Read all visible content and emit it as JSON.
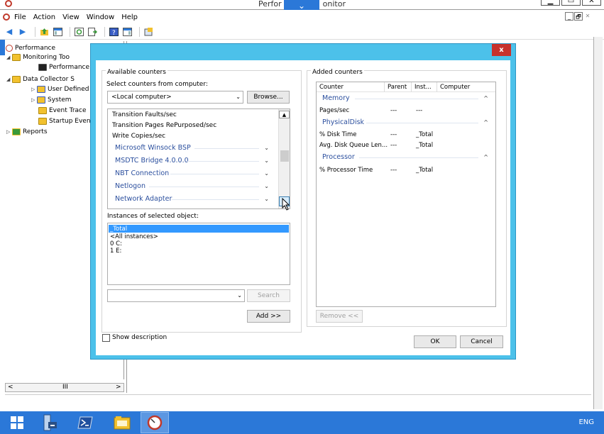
{
  "window": {
    "title": "Performance Monitor",
    "title_left": "Perfor",
    "title_right": "onitor",
    "chevron": "⌄",
    "controls": [
      "▁",
      "▭",
      "✕"
    ]
  },
  "menu": {
    "items": [
      "File",
      "Action",
      "View",
      "Window",
      "Help"
    ]
  },
  "mdi_controls": [
    "_",
    "🗗",
    "✕"
  ],
  "tree": {
    "nodes": [
      {
        "label": "Performance",
        "expander": ""
      },
      {
        "label": "Monitoring Too",
        "expander": "◢"
      },
      {
        "label": "Performance",
        "expander": ""
      },
      {
        "label": "Data Collector S",
        "expander": "◢"
      },
      {
        "label": "User Defined",
        "expander": "▷"
      },
      {
        "label": "System",
        "expander": "▷"
      },
      {
        "label": "Event Trace",
        "expander": ""
      },
      {
        "label": "Startup Even",
        "expander": ""
      },
      {
        "label": "Reports",
        "expander": "▷"
      }
    ],
    "hscroll_left": "<",
    "hscroll_thumb": "III",
    "hscroll_right": ">"
  },
  "dialog": {
    "close": "x",
    "available_title": "Available counters",
    "select_computer_label": "Select counters from computer:",
    "computer_value": "<Local computer>",
    "browse_label": "Browse...",
    "counters": [
      "Transition Faults/sec",
      "Transition Pages RePurposed/sec",
      "Write Copies/sec"
    ],
    "categories": [
      "Microsoft Winsock BSP",
      "MSDTC Bridge 4.0.0.0",
      "NBT Connection",
      "Netlogon",
      "Network Adapter"
    ],
    "instances_label": "Instances of selected object:",
    "instances": [
      "_Total",
      "<All instances>",
      "0 C:",
      "1 E:"
    ],
    "search_value": "",
    "search_label": "Search",
    "add_label": "Add >>",
    "added_title": "Added counters",
    "added_headers": [
      "Counter",
      "Parent",
      "Inst...",
      "Computer"
    ],
    "added_groups": [
      {
        "name": "Memory",
        "rows": [
          {
            "counter": "Pages/sec",
            "parent": "---",
            "instance": "---"
          }
        ]
      },
      {
        "name": "PhysicalDisk",
        "rows": [
          {
            "counter": "% Disk Time",
            "parent": "---",
            "instance": "_Total"
          },
          {
            "counter": "Avg. Disk Queue Len...",
            "parent": "---",
            "instance": "_Total"
          }
        ]
      },
      {
        "name": "Processor",
        "rows": [
          {
            "counter": "% Processor Time",
            "parent": "---",
            "instance": "_Total"
          }
        ]
      }
    ],
    "remove_label": "Remove <<",
    "show_description_label": "Show description",
    "ok_label": "OK",
    "cancel_label": "Cancel"
  },
  "taskbar": {
    "language": "ENG"
  },
  "colors": {
    "dialog_frame": "#4cc1ea",
    "close_red": "#c7312c",
    "taskbar_blue": "#2b78d8",
    "category_blue": "#2b4f9e",
    "selection_blue": "#3399ff"
  }
}
